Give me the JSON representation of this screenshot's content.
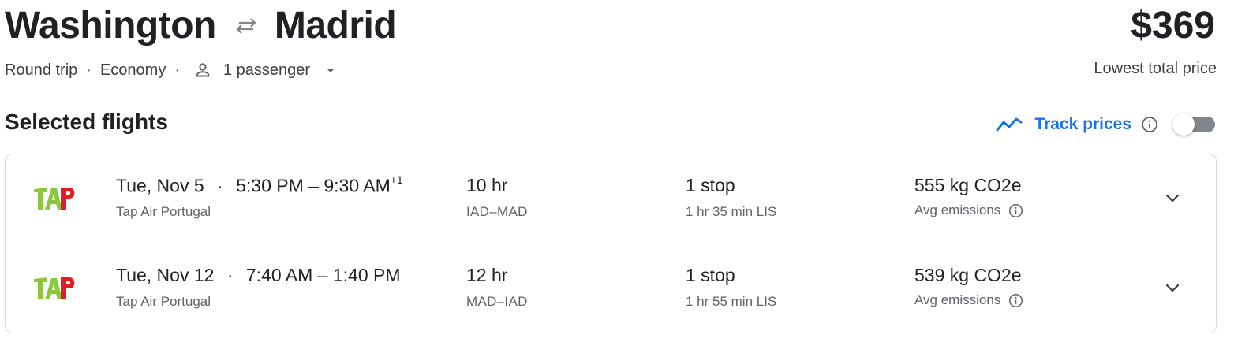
{
  "header": {
    "origin": "Washington",
    "destination": "Madrid",
    "swap_icon": "swap-arrows-icon",
    "price": "$369",
    "price_caption": "Lowest total price"
  },
  "trip_options": {
    "trip_type": "Round trip",
    "cabin": "Economy",
    "separator": "·",
    "passengers": "1 passenger",
    "person_icon": "person-icon",
    "dropdown_icon": "caret-down-icon"
  },
  "selected_flights": {
    "title": "Selected flights",
    "track_prices": {
      "label": "Track prices",
      "icon": "trending-line-icon",
      "info_icon": "info-icon",
      "enabled": false
    },
    "flights": [
      {
        "airline_logo": "TAP",
        "date": "Tue, Nov 5",
        "dot": "·",
        "depart": "5:30 PM",
        "dash": "–",
        "arrive": "9:30 AM",
        "day_offset": "+1",
        "airline": "Tap Air Portugal",
        "duration": "10 hr",
        "route": "IAD–MAD",
        "stops": "1 stop",
        "layover": "1 hr 35 min LIS",
        "emissions": "555 kg CO2e",
        "emissions_label": "Avg emissions"
      },
      {
        "airline_logo": "TAP",
        "date": "Tue, Nov 12",
        "dot": "·",
        "depart": "7:40 AM",
        "dash": "–",
        "arrive": "1:40 PM",
        "day_offset": "",
        "airline": "Tap Air Portugal",
        "duration": "12 hr",
        "route": "MAD–IAD",
        "stops": "1 stop",
        "layover": "1 hr 55 min LIS",
        "emissions": "539 kg CO2e",
        "emissions_label": "Avg emissions"
      }
    ]
  },
  "colors": {
    "accent": "#1a73e8",
    "text": "#202124",
    "secondary_text": "#5f6368",
    "border": "#dadce0",
    "tap_green": "#8dc63f",
    "tap_red": "#e31b23"
  }
}
